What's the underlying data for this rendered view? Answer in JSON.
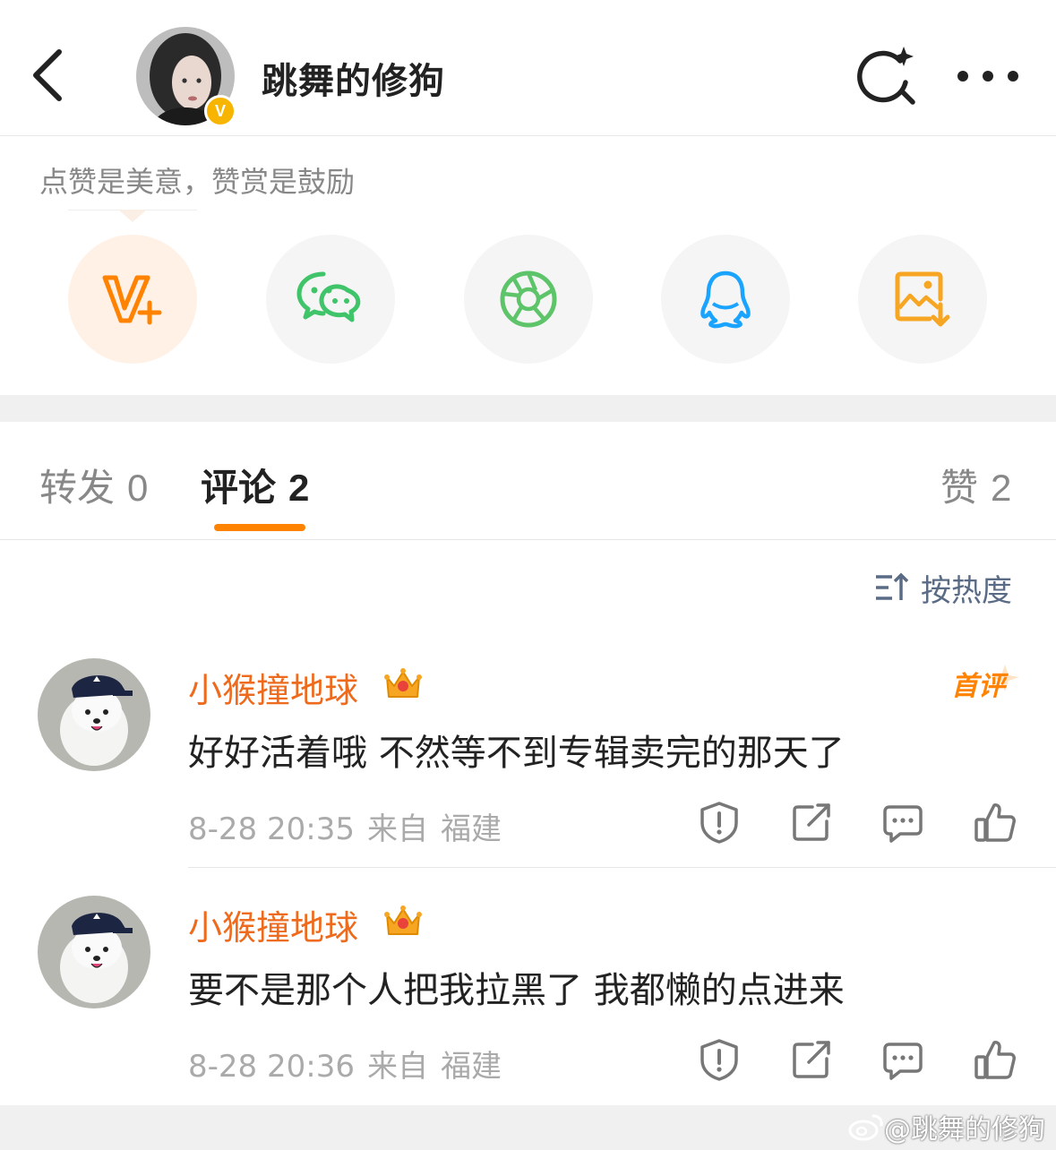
{
  "header": {
    "title": "跳舞的修狗",
    "verified_badge": "V",
    "back_icon": "chevron-left-icon",
    "search_icon": "search-sparkle-icon",
    "more_icon": "more-dots-icon"
  },
  "reward": {
    "prompt": "点赞是美意，赞赏是鼓励"
  },
  "share": {
    "items": [
      {
        "icon": "v-plus-icon",
        "color": "#ff8200"
      },
      {
        "icon": "wechat-icon",
        "color": "#3fc46a"
      },
      {
        "icon": "moments-icon",
        "color": "#5ec46a"
      },
      {
        "icon": "qq-icon",
        "color": "#1aa3ff"
      },
      {
        "icon": "save-image-icon",
        "color": "#f6a623"
      }
    ]
  },
  "tabs": [
    {
      "label": "转发",
      "count": "0"
    },
    {
      "label": "评论",
      "count": "2"
    },
    {
      "label": "赞",
      "count": "2"
    }
  ],
  "sort": {
    "label": "按热度"
  },
  "comments": [
    {
      "user": "小猴撞地球",
      "text": "好好活着哦 不然等不到专辑卖完的那天了",
      "time": "8-28 20:35",
      "source_prefix": "来自",
      "location": "福建",
      "badge": "首评"
    },
    {
      "user": "小猴撞地球",
      "text": "要不是那个人把我拉黑了 我都懒的点进来",
      "time": "8-28 20:36",
      "source_prefix": "来自",
      "location": "福建"
    }
  ],
  "watermark": "@跳舞的修狗",
  "colors": {
    "accent": "#ff8200",
    "username": "#ee6a1c",
    "secondary_text": "#aaaaaa"
  }
}
